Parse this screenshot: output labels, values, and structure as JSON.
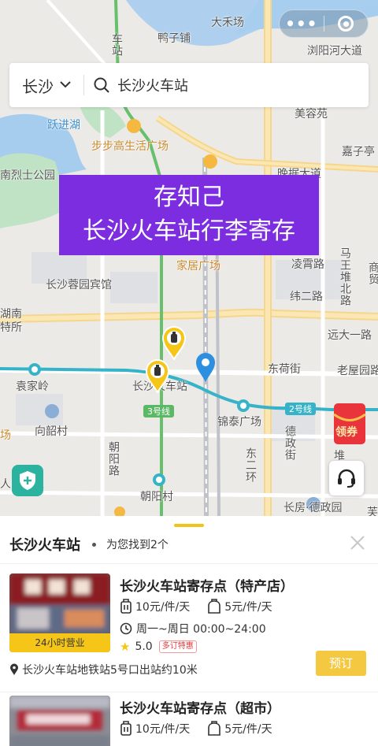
{
  "capsule": {
    "more_icon": "more-dots-icon",
    "close_icon": "target-ring-icon"
  },
  "search": {
    "city": "长沙",
    "query": "长沙火车站"
  },
  "banner": {
    "line1": "存知己",
    "line2": "长沙火车站行李寄存"
  },
  "map": {
    "labels": {
      "dahechang": "大禾场",
      "yazipu": "鸭子铺",
      "liuyanghe": "浏阳河大道",
      "chezhan": "车站",
      "meirongyuan": "美容苑",
      "yuejinhu": "跃进湖",
      "bubugao": "步步高生活广场",
      "jiaziting": "嘉子亭",
      "lieshi": "南烈士公园",
      "wanjuedadao": "晚据大道",
      "jiayiguang": "家居广场",
      "rongyuan": "长沙蓉园宾馆",
      "lingxiaolu": "凌霄路",
      "weiersilu": "纬二路",
      "mawangdui": "马王堆北路",
      "shangmao": "商贸",
      "hunan": "湖南",
      "tesuo": "特所",
      "yuanda": "远大一路",
      "donghejie": "东荷街",
      "laowuyuan": "老屋园路",
      "yuanjialing": "袁家岭",
      "station": "长沙火车站",
      "line3": "3号线",
      "line2": "2号线",
      "jintai": "锦泰广场",
      "xiangshao": "向韶村",
      "dezheng": "德政街",
      "chaoyang": "朝阳路",
      "dongerhuan": "东二环",
      "chang": "场",
      "dui": "堆",
      "shequ": "人民社区",
      "chaoyangcun": "朝阳村",
      "changfang": "长房·德政园",
      "mei": "芙"
    }
  },
  "map_controls": {
    "coupon_label": "领券"
  },
  "sheet": {
    "title": "长沙火车站",
    "result_text": "为您找到2个"
  },
  "results": [
    {
      "title": "长沙火车站寄存点（特产店）",
      "badge": "24小时营业",
      "price_large": "10元/件/天",
      "price_small": "5元/件/天",
      "hours": "周一~周日 00:00~24:00",
      "rating": "5.0",
      "promo": "多订特惠",
      "address": "长沙火车站地铁站5号口出站约10米",
      "book_label": "预订"
    },
    {
      "title": "长沙火车站寄存点（超市）",
      "price_large": "10元/件/天",
      "price_small": "5元/件/天"
    }
  ],
  "colors": {
    "accent": "#f5c518",
    "banner": "#7d2de0",
    "metro": "#36b3c9"
  }
}
